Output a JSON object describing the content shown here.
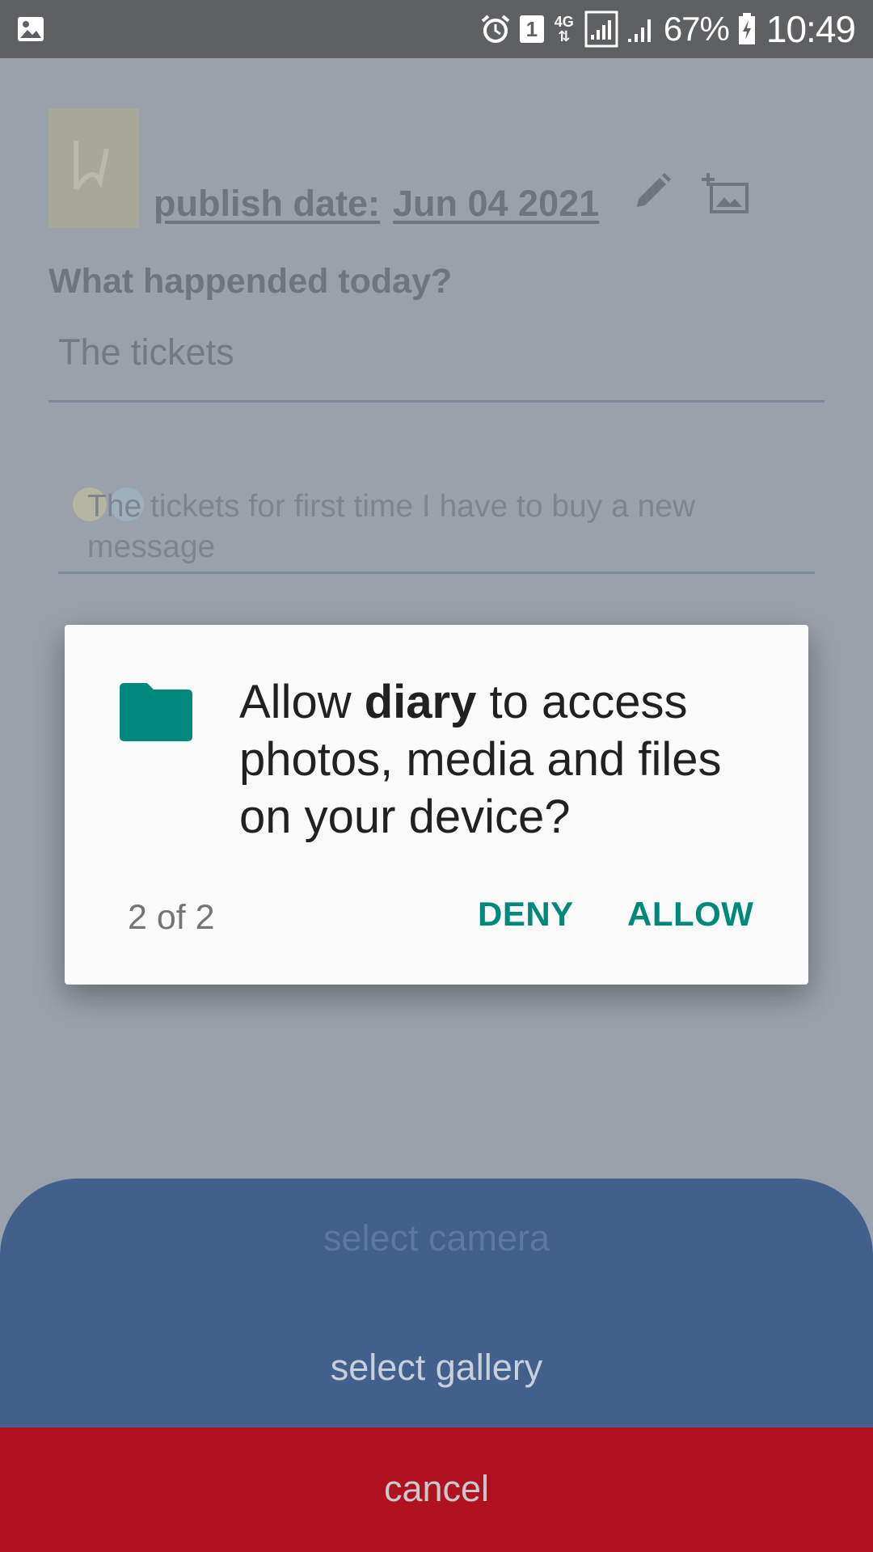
{
  "status_bar": {
    "network_type": "4G",
    "sim_slot": "1",
    "battery_percent": "67%",
    "time": "10:49",
    "icons": [
      "gallery-icon",
      "alarm-icon",
      "sim-icon",
      "network-icon",
      "signal-icon",
      "signal-icon",
      "battery-charging-icon"
    ]
  },
  "form": {
    "publish_label": "publish date:",
    "publish_date": "Jun 04 2021",
    "question": "What happended today?",
    "title_value": "The tickets",
    "body_value": "The tickets for first time I have to buy a new message"
  },
  "dialog": {
    "message_prefix": "Allow ",
    "app_name": "diary",
    "message_suffix": " to access photos, media and files on your device?",
    "counter": "2 of 2",
    "deny_label": "DENY",
    "allow_label": "ALLOW",
    "icon": "folder-icon",
    "accent_color": "#00897b"
  },
  "sheet": {
    "camera_label": "select camera",
    "gallery_label": "select gallery",
    "cancel_label": "cancel",
    "sheet_color": "#42608c",
    "cancel_color": "#b0131f"
  }
}
